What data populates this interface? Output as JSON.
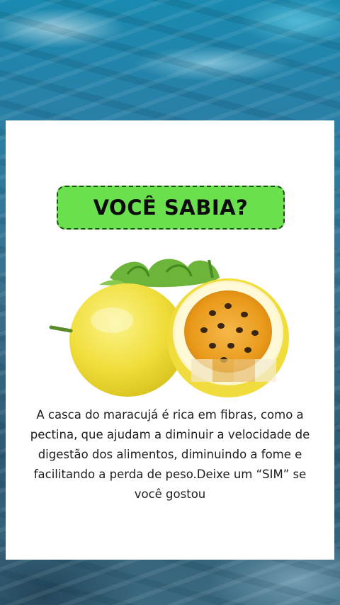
{
  "card": {
    "badge_title": "VOCÊ SABIA?",
    "image": {
      "icon": "passion-fruit-illustration",
      "colors": {
        "peel": "#f2e24a",
        "pulp": "#f0a41c",
        "leaf": "#6cb43a"
      }
    },
    "caption": "A casca do maracujá é rica em fibras, como a pectina, que ajudam a diminuir a velocidade de digestão dos alimentos, diminuindo a fome e facilitando a perda de peso.Deixe um “SIM” se você gostou"
  },
  "colors": {
    "badge_bg": "#6be04e",
    "badge_border": "#1b4d14",
    "card_bg": "#ffffff"
  }
}
